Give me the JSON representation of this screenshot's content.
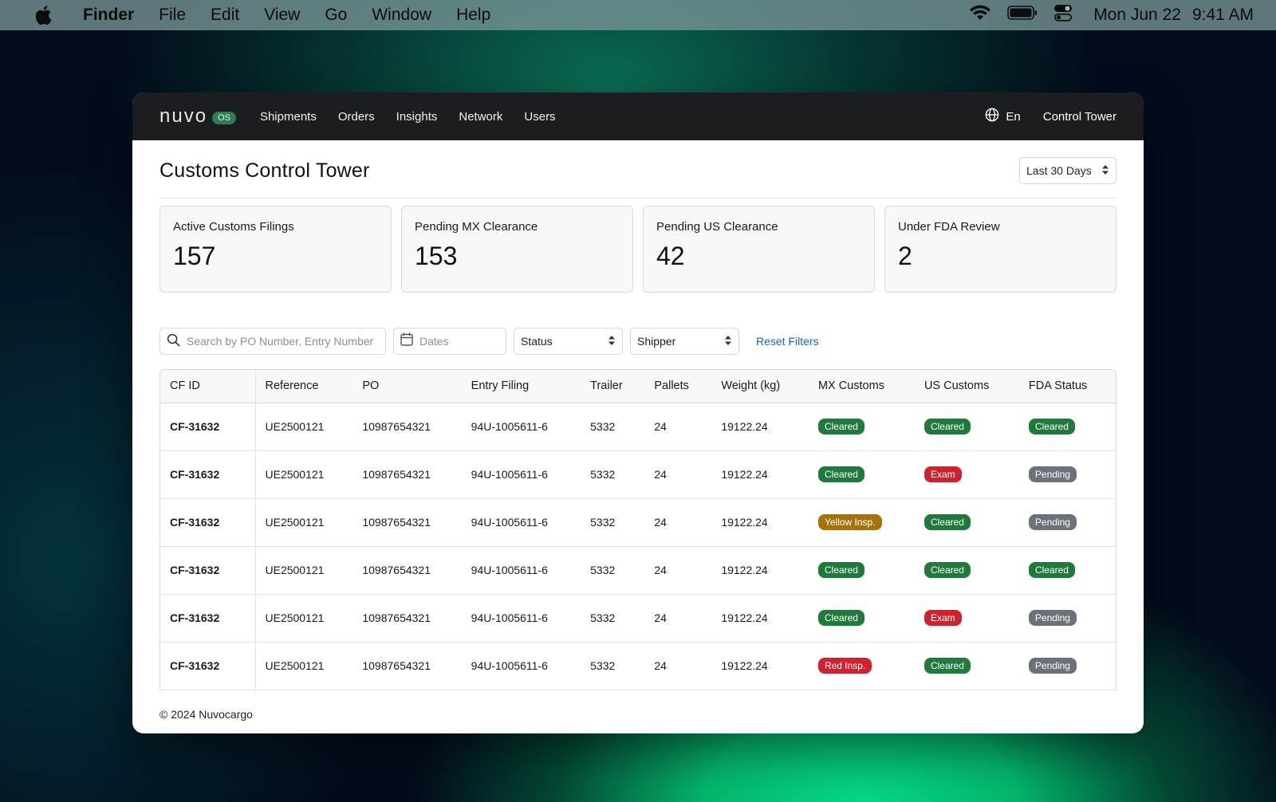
{
  "menubar": {
    "app_name": "Finder",
    "items": [
      "File",
      "Edit",
      "View",
      "Go",
      "Window",
      "Help"
    ],
    "date": "Mon Jun 22",
    "time": "9:41 AM"
  },
  "navbar": {
    "logo_text": "nuvo",
    "logo_badge": "OS",
    "links": [
      "Shipments",
      "Orders",
      "Insights",
      "Network",
      "Users"
    ],
    "language": "En",
    "account": "Control Tower"
  },
  "page": {
    "title": "Customs Control Tower",
    "range": "Last 30 Days"
  },
  "kpis": [
    {
      "label": "Active Customs Filings",
      "value": "157"
    },
    {
      "label": "Pending MX Clearance",
      "value": "153"
    },
    {
      "label": "Pending US Clearance",
      "value": "42"
    },
    {
      "label": "Under FDA Review",
      "value": "2"
    }
  ],
  "filters": {
    "search_placeholder": "Search by PO Number, Entry Number",
    "dates_placeholder": "Dates",
    "status": "Status",
    "shipper": "Shipper",
    "reset": "Reset Filters"
  },
  "table": {
    "columns": [
      "CF ID",
      "Reference",
      "PO",
      "Entry Filing",
      "Trailer",
      "Pallets",
      "Weight (kg)",
      "MX Customs",
      "US Customs",
      "FDA Status"
    ],
    "rows": [
      {
        "cf_id": "CF-31632",
        "reference": "UE2500121",
        "po": "10987654321",
        "entry": "94U-1005611-6",
        "trailer": "5332",
        "pallets": "24",
        "weight": "19122.24",
        "mx": "Cleared",
        "us": "Cleared",
        "fda": "Cleared"
      },
      {
        "cf_id": "CF-31632",
        "reference": "UE2500121",
        "po": "10987654321",
        "entry": "94U-1005611-6",
        "trailer": "5332",
        "pallets": "24",
        "weight": "19122.24",
        "mx": "Cleared",
        "us": "Exam",
        "fda": "Pending"
      },
      {
        "cf_id": "CF-31632",
        "reference": "UE2500121",
        "po": "10987654321",
        "entry": "94U-1005611-6",
        "trailer": "5332",
        "pallets": "24",
        "weight": "19122.24",
        "mx": "Yellow Insp.",
        "us": "Cleared",
        "fda": "Pending"
      },
      {
        "cf_id": "CF-31632",
        "reference": "UE2500121",
        "po": "10987654321",
        "entry": "94U-1005611-6",
        "trailer": "5332",
        "pallets": "24",
        "weight": "19122.24",
        "mx": "Cleared",
        "us": "Cleared",
        "fda": "Cleared"
      },
      {
        "cf_id": "CF-31632",
        "reference": "UE2500121",
        "po": "10987654321",
        "entry": "94U-1005611-6",
        "trailer": "5332",
        "pallets": "24",
        "weight": "19122.24",
        "mx": "Cleared",
        "us": "Exam",
        "fda": "Pending"
      },
      {
        "cf_id": "CF-31632",
        "reference": "UE2500121",
        "po": "10987654321",
        "entry": "94U-1005611-6",
        "trailer": "5332",
        "pallets": "24",
        "weight": "19122.24",
        "mx": "Red Insp.",
        "us": "Cleared",
        "fda": "Pending"
      }
    ]
  },
  "badge_colors": {
    "Cleared": "#1f7a3c",
    "Exam": "#d1202e",
    "Pending": "#6c727b",
    "Yellow Insp.": "#a8720a",
    "Red Insp.": "#d1202e"
  },
  "footer": "© 2024 Nuvocargo"
}
